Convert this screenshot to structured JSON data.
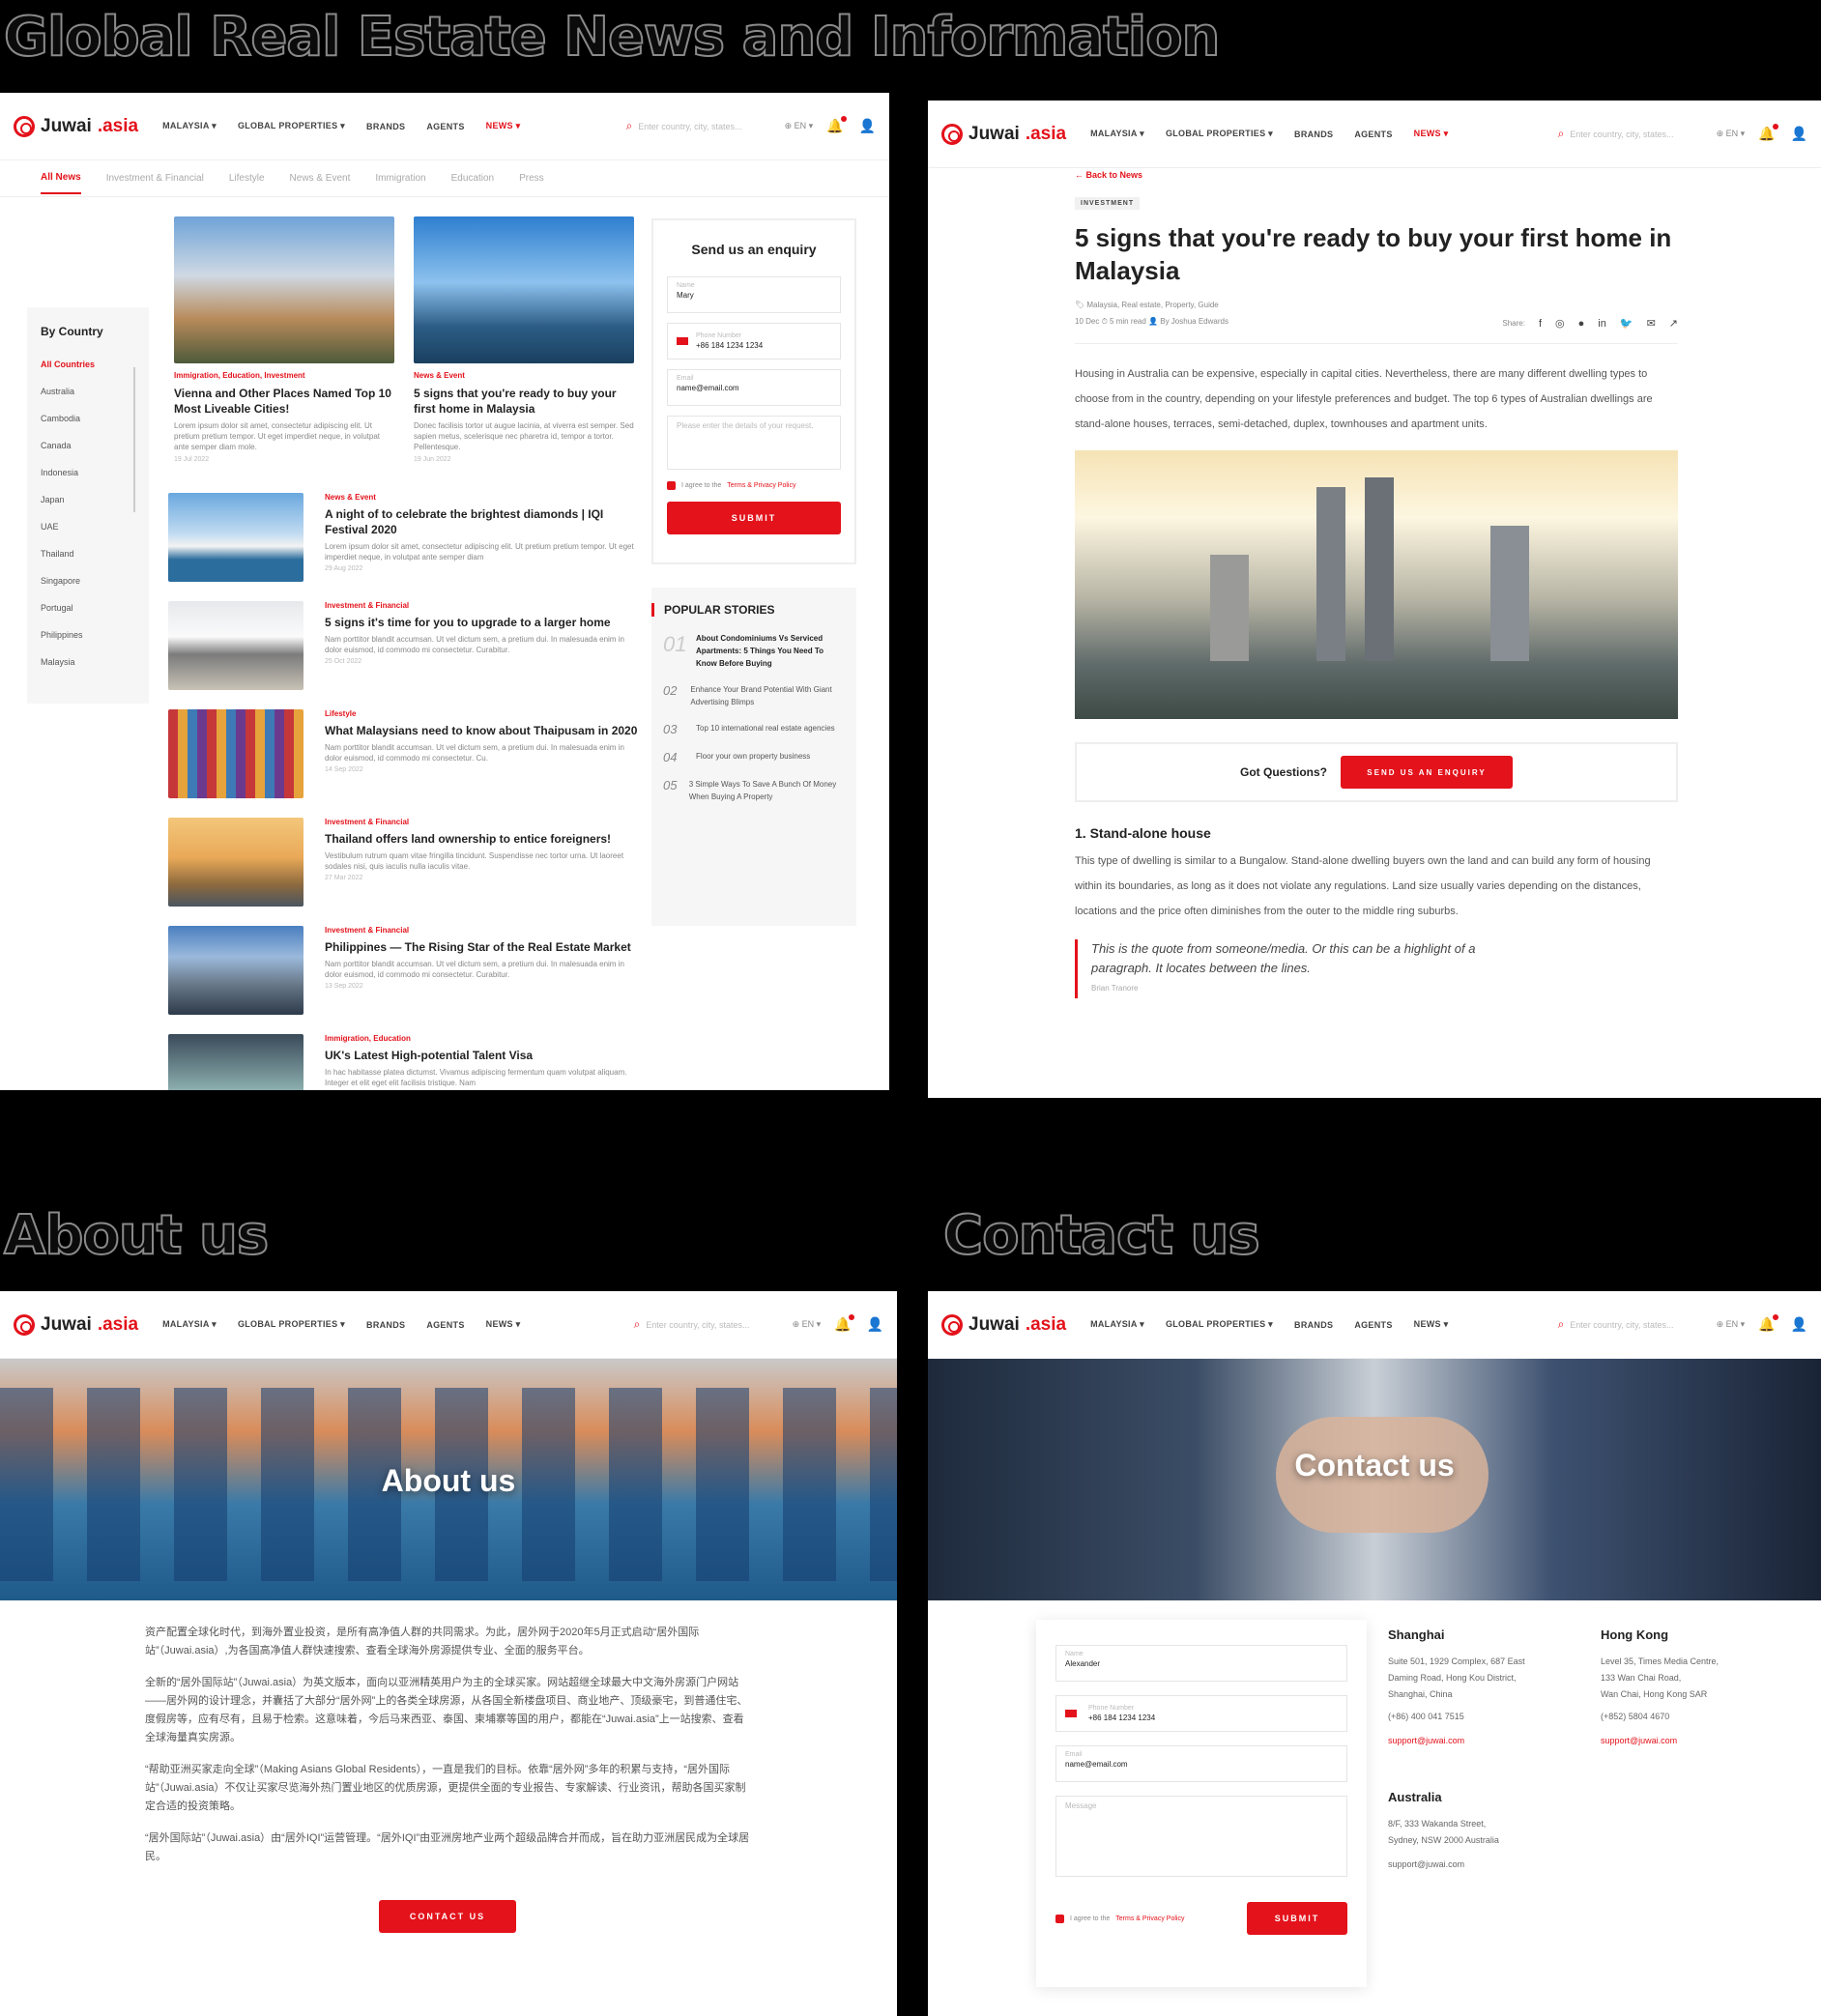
{
  "sections": {
    "news": "Global Real Estate News and Information",
    "about": "About us",
    "contact": "Contact us"
  },
  "nav": {
    "logo_a": "Juwai",
    "logo_b": ".asia",
    "country": "MALAYSIA ▾",
    "global": "GLOBAL PROPERTIES ▾",
    "brands": "BRANDS",
    "agents": "AGENTS",
    "news": "NEWS ▾",
    "search_placeholder": "Enter country, city, states...",
    "lang": "⊕ EN ▾"
  },
  "news_page": {
    "tabs": [
      "All News",
      "Investment & Financial",
      "Lifestyle",
      "News & Event",
      "Immigration",
      "Education",
      "Press"
    ],
    "by_country": "By Country",
    "countries": [
      "All Countries",
      "Australia",
      "Cambodia",
      "Canada",
      "Indonesia",
      "Japan",
      "UAE",
      "Thailand",
      "Singapore",
      "Portugal",
      "Philippines",
      "Malaysia"
    ],
    "featured": [
      {
        "cat": "Immigration, Education, Investment",
        "title": "Vienna and Other Places Named Top 10 Most Liveable Cities!",
        "excerpt": "Lorem ipsum dolor sit amet, consectetur adipiscing elit. Ut pretium pretium tempor. Ut eget imperdiet neque, in volutpat ante semper diam mole.",
        "date": "19 Jul 2022"
      },
      {
        "cat": "News & Event",
        "title": "5 signs that you're ready to buy your first home in Malaysia",
        "excerpt": "Donec facilisis tortor ut augue lacinia, at viverra est semper. Sed sapien metus, scelerisque nec pharetra id, tempor a tortor. Pellentesque.",
        "date": "19 Jun 2022"
      }
    ],
    "list": [
      {
        "cat": "News & Event",
        "title": "A night of to celebrate the brightest diamonds | IQI Festival 2020",
        "excerpt": "Lorem ipsum dolor sit amet, consectetur adipiscing elit. Ut pretium pretium tempor. Ut eget imperdiet neque, in volutpat ante semper diam",
        "date": "29 Aug 2022"
      },
      {
        "cat": "Investment & Financial",
        "title": "5 signs it's time for you to upgrade to a larger home",
        "excerpt": "Nam porttitor blandit accumsan. Ut vel dictum sem, a pretium dui. In malesuada enim in dolor euismod, id commodo mi consectetur. Curabitur.",
        "date": "25 Oct 2022"
      },
      {
        "cat": "Lifestyle",
        "title": "What Malaysians need to know about Thaipusam in 2020",
        "excerpt": "Nam porttitor blandit accumsan. Ut vel dictum sem, a pretium dui. In malesuada enim in dolor euismod, id commodo mi consectetur. Cu.",
        "date": "14 Sep 2022"
      },
      {
        "cat": "Investment & Financial",
        "title": "Thailand offers land ownership to entice foreigners!",
        "excerpt": "Vestibulum rutrum quam vitae fringilla tincidunt. Suspendisse nec tortor urna. Ut laoreet sodales nisi, quis iaculis nulla iaculis vitae.",
        "date": "27 Mar 2022"
      },
      {
        "cat": "Investment & Financial",
        "title": "Philippines — The Rising Star of the Real Estate Market",
        "excerpt": "Nam porttitor blandit accumsan. Ut vel dictum sem, a pretium dui. In malesuada enim in dolor euismod, id commodo mi consectetur. Curabitur.",
        "date": "13 Sep 2022"
      },
      {
        "cat": "Immigration, Education",
        "title": "UK's Latest High-potential Talent Visa",
        "excerpt": "In hac habitasse platea dictumst. Vivamus adipiscing fermentum quam volutpat aliquam. Integer et elit eget elit facilisis tristique. Nam",
        "date": ""
      }
    ],
    "enquiry": {
      "title": "Send us an enquiry",
      "name_label": "Name",
      "name": "Mary",
      "phone_label": "Phone Number",
      "phone": "+86 184 1234 1234",
      "email_label": "Email",
      "email": "name@email.com",
      "details": "Please enter the details of your request.",
      "agree_a": "I agree to the ",
      "agree_b": "Terms & Privacy Policy",
      "submit": "SUBMIT"
    },
    "popular": {
      "title": "POPULAR STORIES",
      "items": [
        {
          "n": "01",
          "t": "About Condominiums Vs Serviced Apartments: 5 Things You Need To Know Before Buying"
        },
        {
          "n": "02",
          "t": "Enhance Your Brand Potential With Giant Advertising Blimps"
        },
        {
          "n": "03",
          "t": "Top 10 international real estate agencies"
        },
        {
          "n": "04",
          "t": "Floor your own property business"
        },
        {
          "n": "05",
          "t": "3 Simple Ways To Save A Bunch Of Money When Buying A Property"
        }
      ]
    }
  },
  "article": {
    "back": "← Back to News",
    "tag": "INVESTMENT",
    "title": "5 signs that you're ready to buy your first home in Malaysia",
    "tags": "Malaysia, Real estate, Property, Guide",
    "meta": "10 Dec   ⏱ 5 min read   👤 By Joshua Edwards",
    "share": "Share:",
    "p1": "Housing in Australia can be expensive, especially in capital cities. Nevertheless, there are many different dwelling types to choose from in the country, depending on your lifestyle preferences and budget. The top 6 types of Australian dwellings are stand-alone houses, terraces, semi-detached, duplex, townhouses and apartment units.",
    "got": "Got Questions?",
    "send": "SEND US AN ENQUIRY",
    "h2": "1. Stand-alone house",
    "p2": "This type of dwelling is similar to a Bungalow. Stand-alone dwelling buyers own the land and can build any form of housing within its boundaries, as long as it does not violate any regulations. Land size usually varies depending on the distances, locations and the price often diminishes from the outer to the middle ring suburbs.",
    "quote": "This is the quote from someone/media. Or this can be a highlight of a paragraph.  It locates between the lines.",
    "quote_by": "Brian Tranore"
  },
  "about": {
    "hero": "About us",
    "p": [
      "资产配置全球化时代，到海外置业投资，是所有高净值人群的共同需求。为此，居外网于2020年5月正式启动“居外国际站”（Juwai.asia）,为各国高净值人群快速搜索、查看全球海外房源提供专业、全面的服务平台。",
      "全新的“居外国际站”（Juwai.asia）为英文版本，面向以亚洲精英用户为主的全球买家。网站超继全球最大中文海外房源门户网站——居外网的设计理念，并囊括了大部分“居外网”上的各类全球房源，从各国全新楼盘项目、商业地产、顶级豪宅，到普通住宅、度假房等，应有尽有，且易于检索。这意味着，今后马来西亚、泰国、柬埔寨等国的用户，都能在“Juwai.asia”上一站搜索、查看全球海量真实房源。",
      "“帮助亚洲买家走向全球”（Making Asians Global Residents），一直是我们的目标。依靠“居外网”多年的积累与支持，“居外国际站”（Juwai.asia）不仅让买家尽览海外热门置业地区的优质房源，更提供全面的专业报告、专家解读、行业资讯，帮助各国买家制定合适的投资策略。",
      "“居外国际站”（Juwai.asia）由“居外IQI”运营管理。“居外IQI”由亚洲房地产业两个超级品牌合并而成，旨在助力亚洲居民成为全球居民。"
    ],
    "button": "CONTACT US"
  },
  "contact": {
    "hero": "Contact us",
    "name_label": "Name",
    "name": "Alexander",
    "phone_label": "Phone Number",
    "phone": "+86 184 1234 1234",
    "email_label": "Email",
    "email": "name@email.com",
    "message": "Message",
    "agree_a": "I agree to the ",
    "agree_b": "Terms & Privacy Policy",
    "submit": "SUBMIT",
    "offices": [
      {
        "city": "Shanghai",
        "addr": [
          "Suite 501, 1929 Complex, 687 East",
          "Daming Road, Hong Kou District,",
          "Shanghai, China"
        ],
        "phone": "(+86) 400 041 7515",
        "email": "support@juwai.com"
      },
      {
        "city": "Hong Kong",
        "addr": [
          "Level 35, Times Media Centre,",
          "133 Wan Chai Road,",
          "Wan Chai, Hong Kong SAR"
        ],
        "phone": "(+852) 5804 4670",
        "email": "support@juwai.com"
      },
      {
        "city": "Australia",
        "addr": [
          "8/F, 333 Wakanda Street,",
          "Sydney, NSW 2000 Australia"
        ],
        "phone": "",
        "email": "support@juwai.com"
      }
    ]
  },
  "colors": {
    "accent": "#e3121b"
  }
}
